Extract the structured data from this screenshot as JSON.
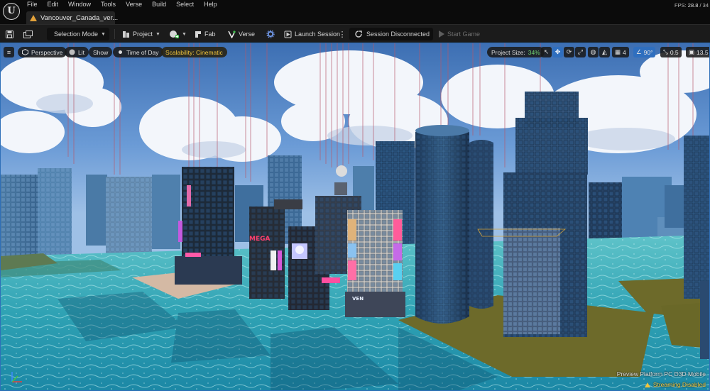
{
  "app": {
    "logo_letter": "U",
    "menu": [
      "File",
      "Edit",
      "Window",
      "Tools",
      "Verse",
      "Build",
      "Select",
      "Help"
    ],
    "fps_label": "FPS:",
    "fps_value": "28.8",
    "fps_extra": "/ 34"
  },
  "tabs": [
    {
      "label": "Vancouver_Canada_ver..."
    }
  ],
  "toolbar": {
    "selection_mode": "Selection Mode",
    "project": "Project",
    "fab": "Fab",
    "verse": "Verse",
    "launch_session": "Launch Session",
    "session_status": "Session Disconnected",
    "start_game": "Start Game"
  },
  "viewport": {
    "perspective": "Perspective",
    "lit": "Lit",
    "show": "Show",
    "time_of_day": "Time of Day",
    "scalability": "Scalability: Cinematic",
    "project_size_label": "Project Size:",
    "project_size_value": "34%",
    "grid_snap": "4",
    "rotation_snap": "90°",
    "scale_snap": "0.5",
    "camera_speed": "13.5",
    "preview_platform": "Preview Platform",
    "preview_platform_value": "PC D3D Mobile",
    "streaming_status": "Streaming Disabled",
    "billboard_texts": [
      "MEGA",
      "VEN"
    ]
  },
  "colors": {
    "accent_blue": "#2f6fbf",
    "scalability_yellow": "#f0c43c",
    "project_size_green": "#6fd06f",
    "water": "#3aa7b8",
    "sky": "#4f86c9"
  }
}
